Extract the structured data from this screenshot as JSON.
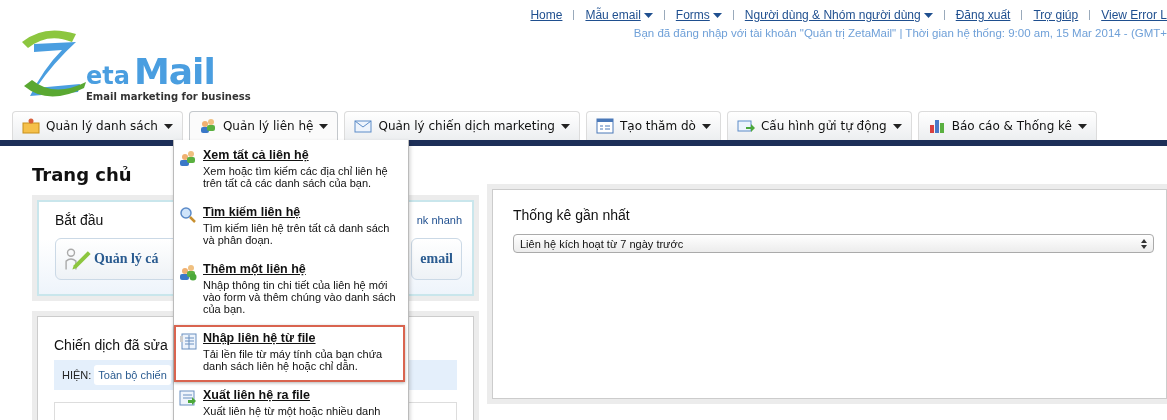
{
  "logo": {
    "letters": "eta",
    "word": "Mail",
    "tagline": "Email marketing for business"
  },
  "top_links": [
    {
      "label": "Home",
      "dropdown": false
    },
    {
      "label": "Mẫu email",
      "dropdown": true
    },
    {
      "label": "Forms",
      "dropdown": true
    },
    {
      "label": "Người dùng & Nhóm người dùng",
      "dropdown": true
    },
    {
      "label": "Đăng xuất",
      "dropdown": false
    },
    {
      "label": "Trợ giúp",
      "dropdown": false
    },
    {
      "label": "View Error L",
      "dropdown": false
    }
  ],
  "login_info": "Bạn đã đăng nhập với tài khoản \"Quản trị ZetaMail\" | Thời gian hệ thống: 9:00 am, 15 Mar 2014 - (GMT+",
  "tabs": [
    {
      "label": "Quản lý danh sách",
      "kind": "folder",
      "selected": false
    },
    {
      "label": "Quản lý liên hệ",
      "kind": "people",
      "selected": true
    },
    {
      "label": "Quản lý chiến dịch marketing",
      "kind": "envelope",
      "selected": false
    },
    {
      "label": "Tạo thăm dò",
      "kind": "form",
      "selected": false
    },
    {
      "label": "Cấu hình gửi tự động",
      "kind": "send",
      "selected": false
    },
    {
      "label": "Báo cáo & Thống kê",
      "kind": "chart",
      "selected": false
    }
  ],
  "menu": [
    {
      "title": "Xem tất cả liên hệ",
      "desc": "Xem hoặc tìm kiếm các địa chỉ liên hệ trên tất cả các danh sách của bạn.",
      "kind": "people",
      "selected": false
    },
    {
      "title": "Tìm kiếm liên hệ",
      "desc": "Tìm kiếm liên hệ trên tất cả danh sách và phân đoạn.",
      "kind": "search",
      "selected": false
    },
    {
      "title": "Thêm một liên hệ",
      "desc": "Nhập thông tin chi tiết của liên hệ mới vào form và thêm chúng vào danh sách của bạn.",
      "kind": "add",
      "selected": false
    },
    {
      "title": "Nhập liên hệ từ file",
      "desc": "Tải lền file từ máy tính của bạn chứa danh sách liên hệ hoặc chỉ dẫn.",
      "kind": "import",
      "selected": true
    },
    {
      "title": "Xuất liên hệ ra file",
      "desc": "Xuất liên hệ từ một hoặc nhiều danh",
      "kind": "export",
      "selected": false
    }
  ],
  "page_title": "Trang chủ",
  "start_panel": {
    "title": "Bắt đầu",
    "link": "nk nhanh",
    "buttons": [
      "Quản lý cá",
      "email"
    ]
  },
  "campaign_panel": {
    "title": "Chiến dịch đã sửa",
    "filter_label": "HIỆN:",
    "filter_value": "Toàn bộ chiến"
  },
  "stats_panel": {
    "title": "Thống kê gần nhất",
    "select_value": "Liên hệ kích hoạt từ 7 ngày trước"
  }
}
